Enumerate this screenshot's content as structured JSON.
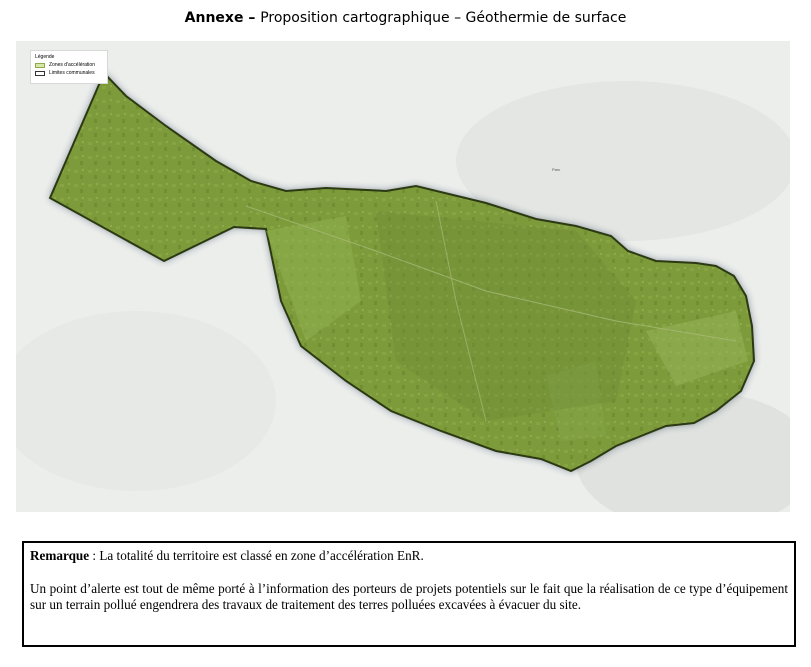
{
  "title": {
    "prefix": "Annexe",
    "dash": " – ",
    "text": "Proposition cartographique – Géothermie de surface"
  },
  "map": {
    "legend": {
      "title": "Légende",
      "items": [
        {
          "label": "Zones d'accélération",
          "swatch": "fill",
          "color": "#d5e8a6"
        },
        {
          "label": "Limites communales",
          "swatch": "outline",
          "color": "#333333"
        }
      ]
    },
    "place_label": "Parc",
    "colors": {
      "zone_fill": "#7d9b3a",
      "boundary": "#2b3a12",
      "background": "#eceeec"
    }
  },
  "remark": {
    "label": "Remarque",
    "first_line": " : La totalité du territoire est classé en zone d’accélération EnR.",
    "paragraph": "Un point d’alerte est tout de même porté à l’information des porteurs de projets potentiels sur le fait que la réalisation de ce type d’équipement sur un terrain pollué engendrera des travaux de traitement des terres polluées excavées à évacuer du site."
  }
}
